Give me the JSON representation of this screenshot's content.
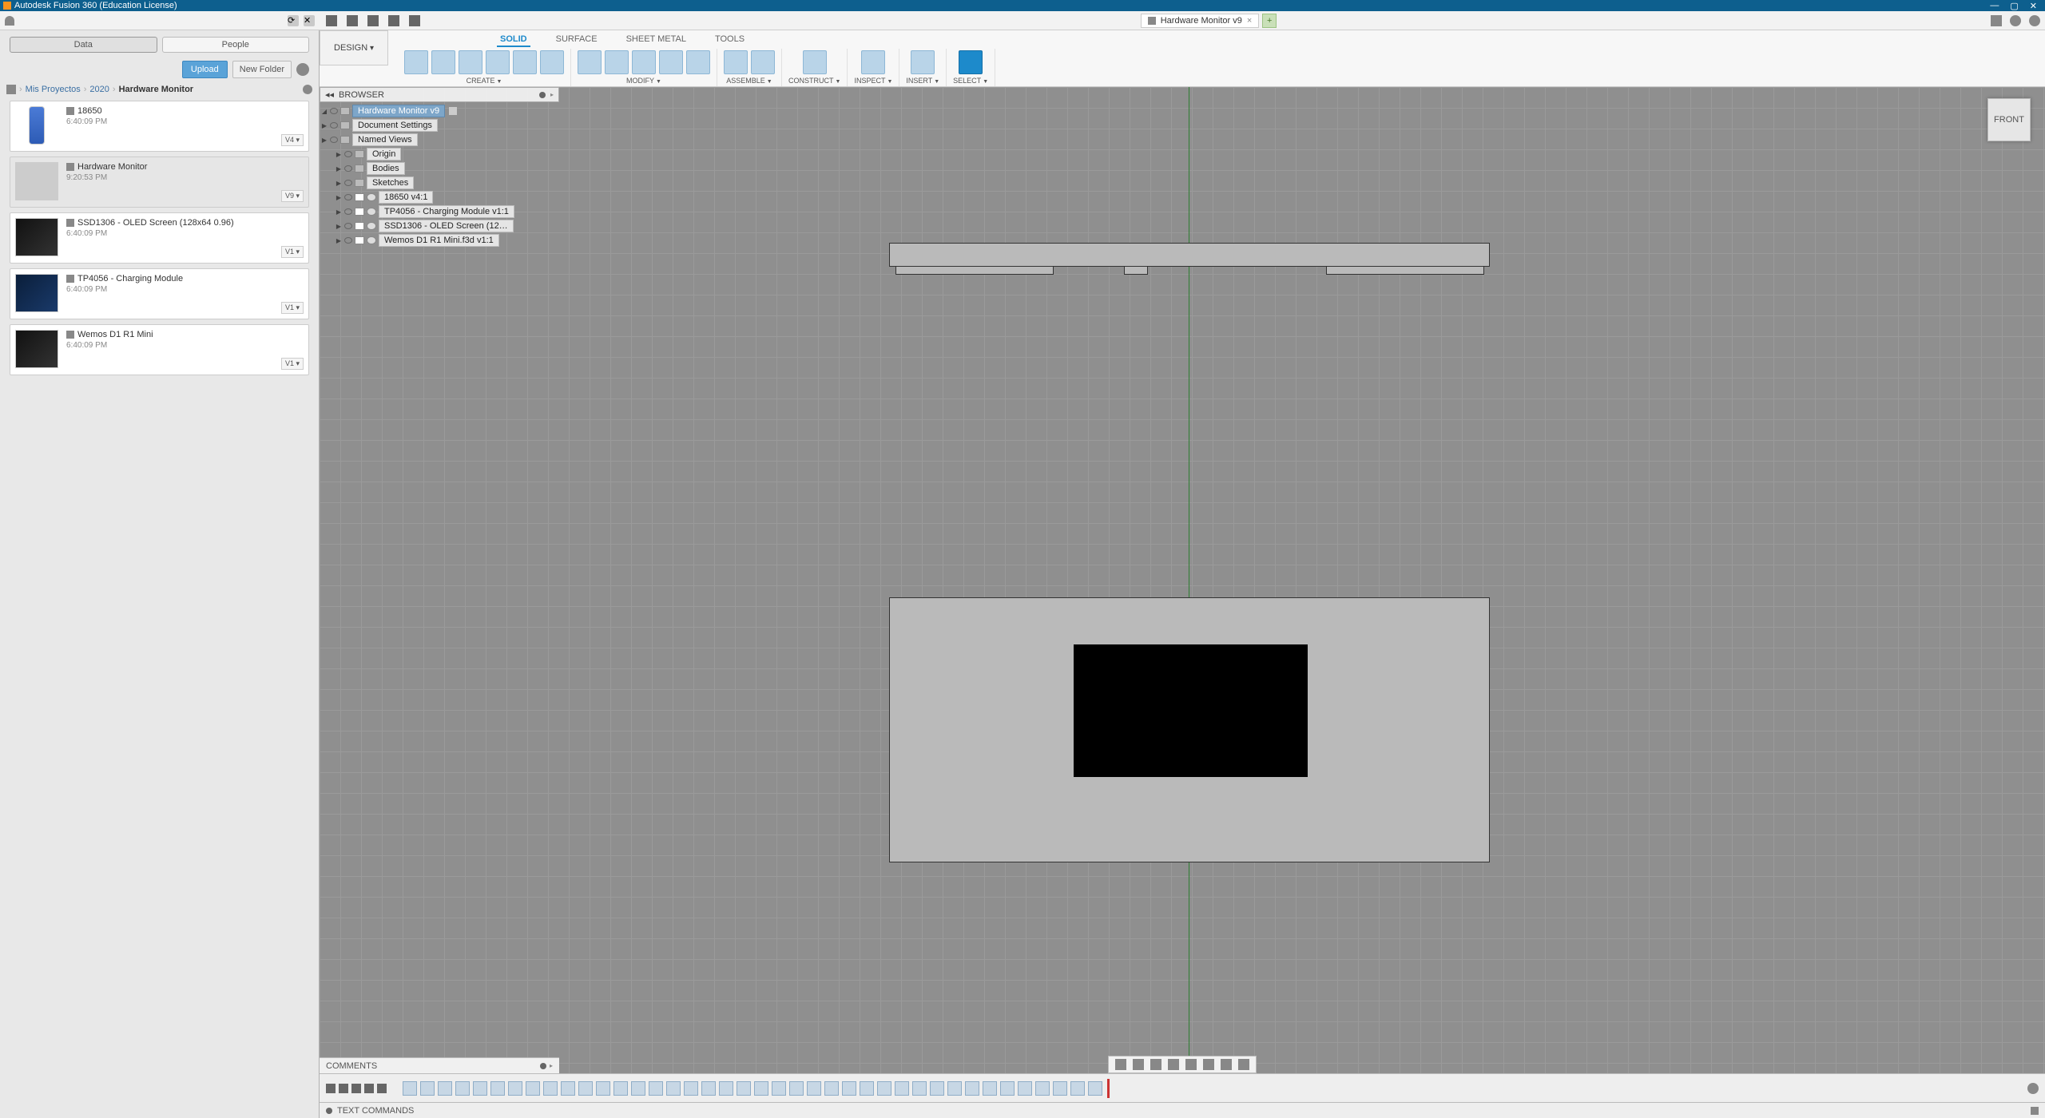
{
  "title": "Autodesk Fusion 360 (Education License)",
  "document": {
    "name": "Hardware Monitor v9"
  },
  "viewcube": "FRONT",
  "sidebar": {
    "tabs": {
      "data": "Data",
      "people": "People"
    },
    "actions": {
      "upload": "Upload",
      "newfolder": "New Folder"
    },
    "breadcrumbs": [
      "Mis Proyectos",
      "2020",
      "Hardware Monitor"
    ],
    "assets": [
      {
        "name": "18650",
        "ts": "6:40:09 PM",
        "ver": "V4",
        "thumb": "battery"
      },
      {
        "name": "Hardware Monitor",
        "ts": "9:20:53 PM",
        "ver": "V9",
        "thumb": "box",
        "active": true
      },
      {
        "name": "SSD1306 - OLED Screen (128x64 0.96)",
        "ts": "6:40:09 PM",
        "ver": "V1",
        "thumb": "chip"
      },
      {
        "name": "TP4056 - Charging Module",
        "ts": "6:40:09 PM",
        "ver": "V1",
        "thumb": "pcb"
      },
      {
        "name": "Wemos D1 R1 Mini",
        "ts": "6:40:09 PM",
        "ver": "V1",
        "thumb": "chip"
      }
    ]
  },
  "ribbon": {
    "workspace": "DESIGN",
    "tabs": [
      "SOLID",
      "SURFACE",
      "SHEET METAL",
      "TOOLS"
    ],
    "active_tab": "SOLID",
    "groups": [
      "CREATE",
      "MODIFY",
      "ASSEMBLE",
      "CONSTRUCT",
      "INSPECT",
      "INSERT",
      "SELECT"
    ]
  },
  "browser": {
    "title": "BROWSER",
    "root": "Hardware Monitor v9",
    "nodes": [
      {
        "label": "Document Settings",
        "icon": "gear"
      },
      {
        "label": "Named Views",
        "icon": "folder"
      },
      {
        "label": "Origin",
        "icon": "folder",
        "indent": 1
      },
      {
        "label": "Bodies",
        "icon": "folder",
        "indent": 1
      },
      {
        "label": "Sketches",
        "icon": "folder",
        "indent": 1
      },
      {
        "label": "18650 v4:1",
        "icon": "link",
        "indent": 1
      },
      {
        "label": "TP4056 - Charging Module v1:1",
        "icon": "link",
        "indent": 1
      },
      {
        "label": "SSD1306 - OLED Screen (12…",
        "icon": "link",
        "indent": 1
      },
      {
        "label": "Wemos D1 R1 Mini.f3d v1:1",
        "icon": "link",
        "indent": 1
      }
    ]
  },
  "comments": "COMMENTS",
  "textcmd": "TEXT COMMANDS",
  "timeline_steps": 40
}
